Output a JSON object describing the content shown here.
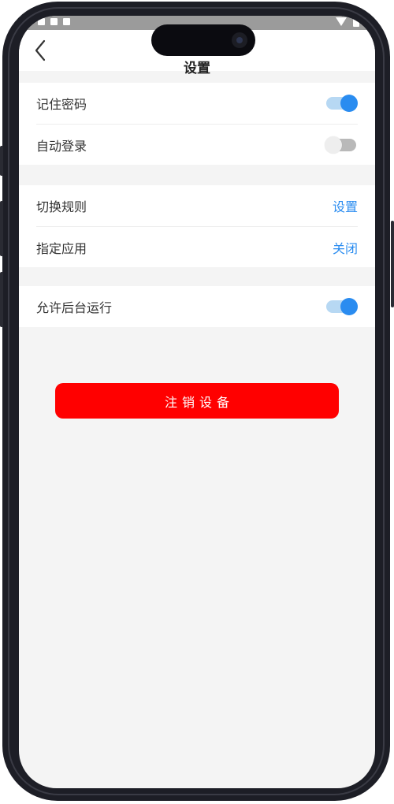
{
  "header": {
    "title": "设置"
  },
  "groups": [
    {
      "rows": [
        {
          "label": "记住密码",
          "control": "toggle",
          "on": true
        },
        {
          "label": "自动登录",
          "control": "toggle",
          "on": false
        }
      ]
    },
    {
      "rows": [
        {
          "label": "切换规则",
          "control": "link",
          "action": "设置"
        },
        {
          "label": "指定应用",
          "control": "link",
          "action": "关闭"
        }
      ]
    },
    {
      "rows": [
        {
          "label": "允许后台运行",
          "control": "toggle",
          "on": true
        }
      ]
    }
  ],
  "logout_button": {
    "label": "注销设备"
  },
  "colors": {
    "accent": "#2a8cf0",
    "danger": "#ff0000",
    "background": "#f4f4f4",
    "toggle_off": "#b9b9b9"
  },
  "icons": {
    "back": "chevron-left-icon"
  }
}
